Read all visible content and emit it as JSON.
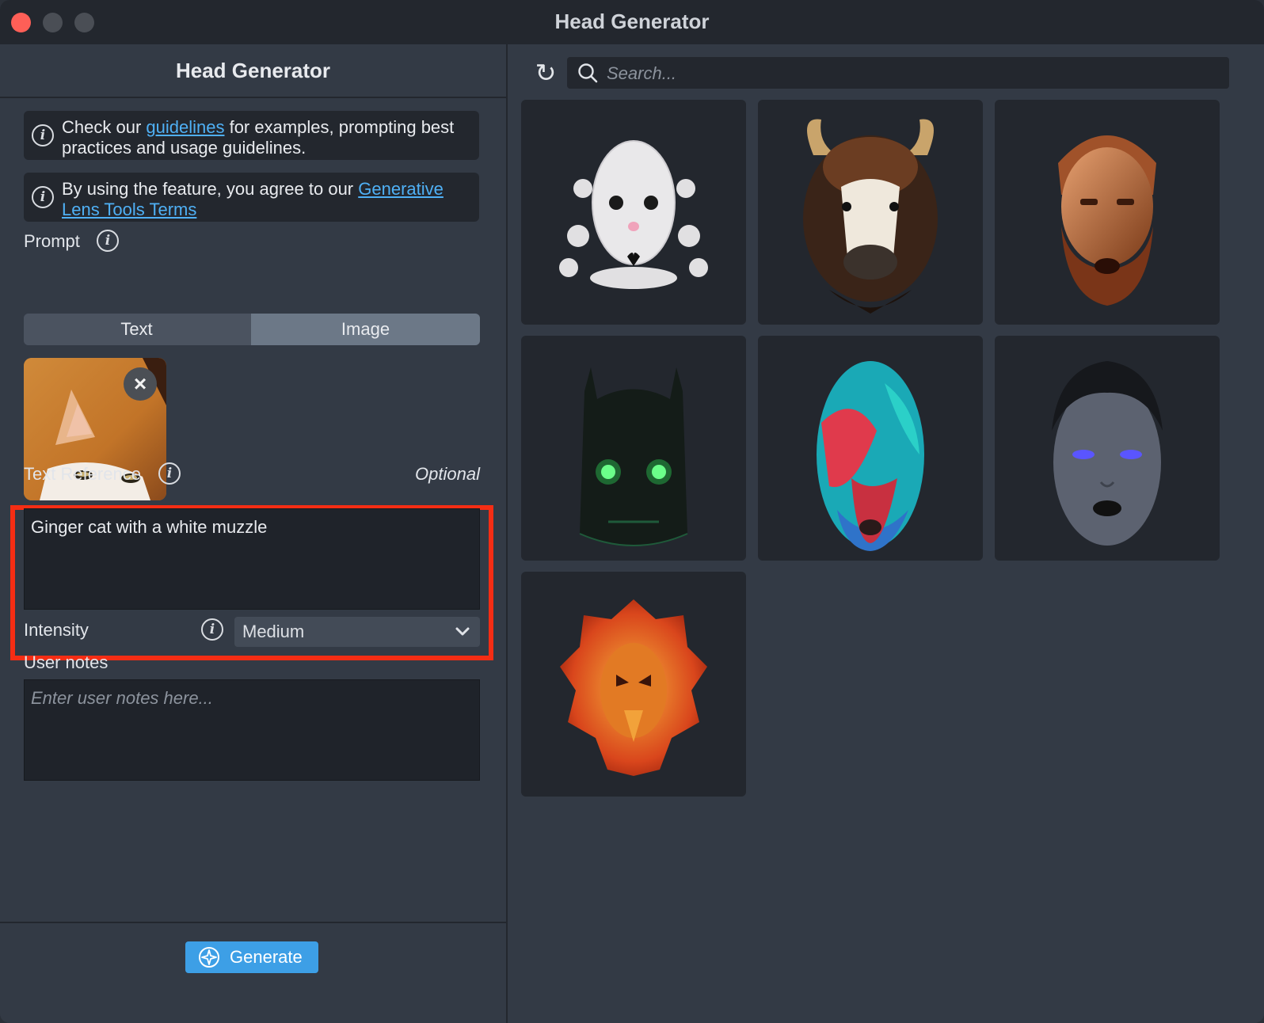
{
  "window": {
    "title": "Head Generator"
  },
  "left_panel": {
    "header": "Head Generator",
    "notice1": {
      "prefix": "Check our ",
      "link": "guidelines",
      "suffix": " for examples, prompting best practices and usage guidelines."
    },
    "notice2": {
      "prefix": "By using the feature, you agree to our ",
      "link": "Generative Lens Tools Terms"
    },
    "prompt_label": "Prompt",
    "prompt_tabs": [
      {
        "label": "Text",
        "selected": false
      },
      {
        "label": "Image",
        "selected": true
      }
    ],
    "image_remove_icon": "close-icon",
    "text_reference": {
      "label": "Text Reference",
      "optional_label": "Optional",
      "value": "Ginger cat with a white muzzle"
    },
    "intensity": {
      "label": "Intensity",
      "value": "Medium"
    },
    "user_notes": {
      "label": "User notes",
      "placeholder": "Enter user notes here..."
    },
    "generate_button": "Generate"
  },
  "right_panel": {
    "search_placeholder": "Search...",
    "results": [
      {
        "icon": "plush-ghost-head"
      },
      {
        "icon": "bison-head"
      },
      {
        "icon": "bronze-bearded-man-head"
      },
      {
        "icon": "dark-creature-green-eyes-head"
      },
      {
        "icon": "feathered-bird-head"
      },
      {
        "icon": "grey-woman-head"
      },
      {
        "icon": "fire-phoenix-lion-head"
      }
    ]
  },
  "colors": {
    "accent": "#3d9fe6",
    "highlight": "#f52d14",
    "link": "#4fb0f5"
  }
}
